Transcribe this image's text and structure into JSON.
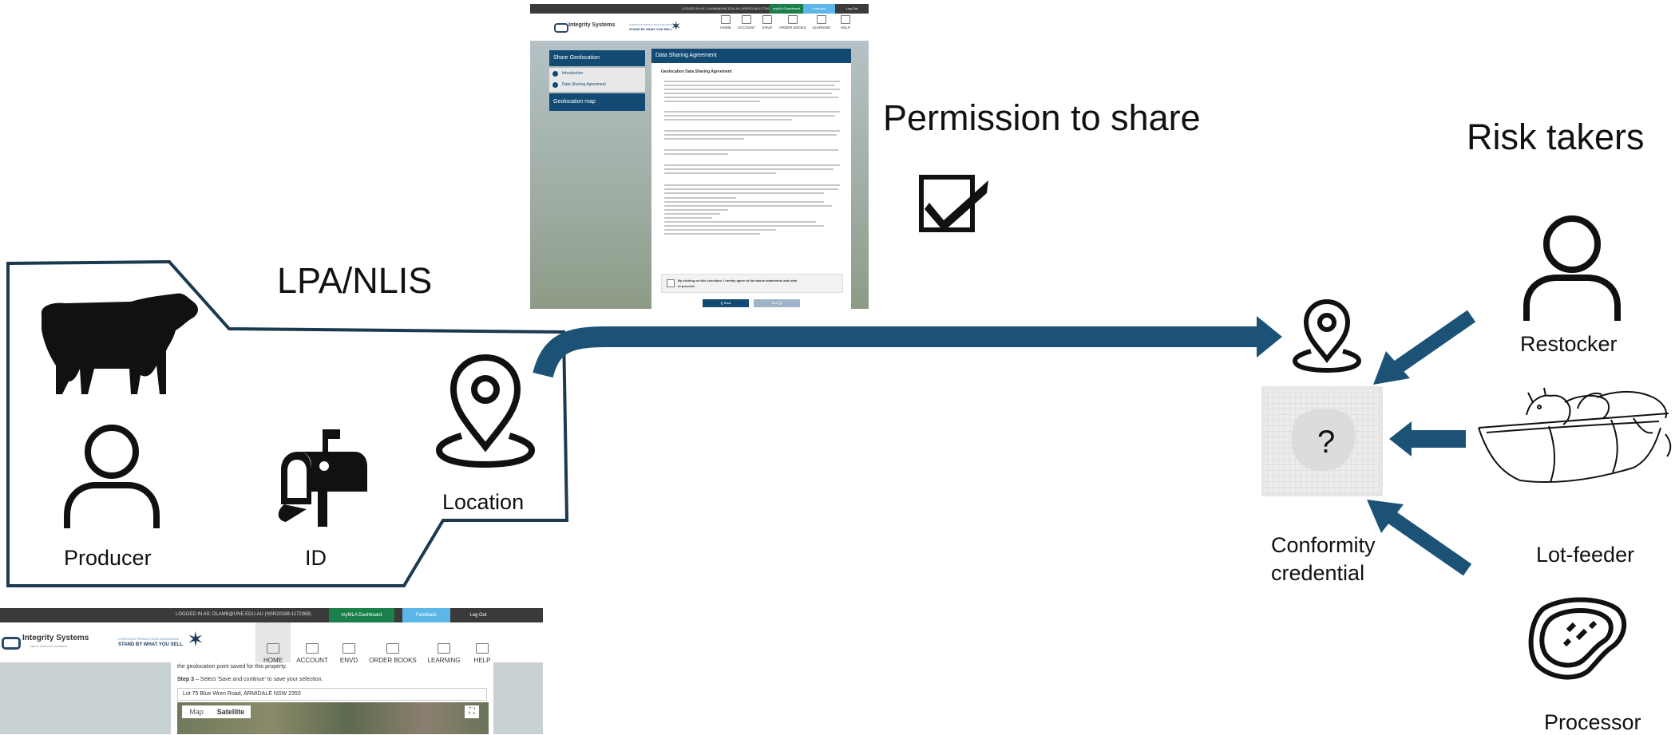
{
  "labels": {
    "lpa_nlis": "LPA/NLIS",
    "producer": "Producer",
    "id": "ID",
    "location": "Location",
    "permission": "Permission to share",
    "risk_takers": "Risk takers",
    "restocker": "Restocker",
    "lot_feeder": "Lot-feeder",
    "processor": "Processor",
    "conformity_line1": "Conformity",
    "conformity_line2": "credential",
    "question_mark": "?"
  },
  "icons": [
    "cow-icon",
    "person-icon",
    "mailbox-icon",
    "location-pin-icon",
    "checkbox-checked-icon",
    "meat-steak-icon",
    "cattle-trough-icon"
  ],
  "colors": {
    "arrow": "#1b5276",
    "outline": "#1b3a4e",
    "site_nav": "#124a74"
  },
  "screenshot_share": {
    "top_strip": "LOGGED IN AS: DLAMB@UNE.EDU.AU (NSR20188-1172368)",
    "dashboard": "myMLA Dashboard",
    "feedback": "Feedback",
    "logout": "Log Out",
    "brand": "Integrity Systems",
    "tagline_top": "LIVESTOCK PRODUCTION ASSURANCE",
    "tagline": "STAND BY WHAT YOU SELL",
    "nav": [
      "HOME",
      "ACCOUNT",
      "ENVD",
      "ORDER BOOKS",
      "LEARNING",
      "HELP"
    ],
    "side_title": "Share Geolocation",
    "steps": [
      "Introduction",
      "Data Sharing Agreement"
    ],
    "side_map": "Geolocation map",
    "panel_title": "Data Sharing Agreement",
    "panel_subtitle": "Geolocation Data Sharing Agreement",
    "checkbox_text_1": "By clicking on this checkbox, I hereby agree to the above statements and wish",
    "checkbox_text_2": "to proceed.",
    "back": "❮ Back",
    "next": "Next ❯"
  },
  "screenshot_map": {
    "top_strip": "LOGGED IN AS: DLAMB@UNE.EDU.AU (NSR20188-1172368)",
    "dashboard": "myMLA Dashboard",
    "feedback": "Feedback",
    "logout": "Log Out",
    "brand": "Integrity Systems",
    "brand_sub": "MEAT & LIVESTOCK AUSTRALIA",
    "tagline_top": "LIVESTOCK PRODUCTION ASSURANCE",
    "tagline": "STAND BY WHAT YOU SELL",
    "nav": [
      "HOME",
      "ACCOUNT",
      "ENVD",
      "ORDER BOOKS",
      "LEARNING",
      "HELP"
    ],
    "text_geopoint": "the geolocation point saved for this property.",
    "step_label": "Step 3",
    "step_text": " – Select 'Save and continue' to save your selection.",
    "address": "Lot 75 Blue Wren Road, ARMIDALE NSW 2350",
    "map_tab": "Map",
    "satellite_tab": "Satellite"
  }
}
